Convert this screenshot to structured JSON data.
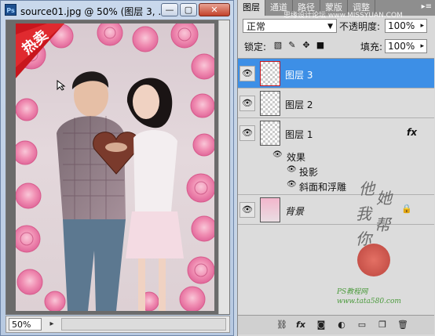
{
  "document": {
    "app_icon": "Ps",
    "title": "source01.jpg @ 50% (图层 3, ...",
    "window_buttons": {
      "minimize": "—",
      "restore": "▢",
      "close": "✕"
    },
    "badge_text": "热卖",
    "zoom": "50%"
  },
  "panel": {
    "tabs": [
      "图层",
      "通道",
      "路径",
      "蒙版",
      "调整"
    ],
    "watermark_url": "思缘设计论坛 www.MISSYUAN.COM",
    "blend_mode": "正常",
    "opacity_label": "不透明度:",
    "opacity_value": "100%",
    "lock_label": "锁定:",
    "fill_label": "填充:",
    "fill_value": "100%",
    "layers": [
      {
        "name": "图层 3",
        "selected": true
      },
      {
        "name": "图层 2",
        "selected": false
      },
      {
        "name": "图层 1",
        "selected": false,
        "fx": "fx"
      }
    ],
    "effects_label": "效果",
    "effects": [
      "投影",
      "斜面和浮雕"
    ],
    "background_layer": "背景",
    "signature_chars": [
      "他",
      "她",
      "我",
      "帮",
      "你"
    ],
    "footer_text": "PS教程网 www.tata580.com"
  },
  "colors": {
    "selection": "#3d8fe6",
    "panel_bg": "#d9d9d9",
    "badge_red": "#c8161d"
  },
  "icons": [
    "eye-icon",
    "lock-icon",
    "link-icon",
    "fx-icon",
    "mask-icon",
    "adjustment-icon",
    "folder-icon",
    "new-layer-icon",
    "trash-icon"
  ]
}
